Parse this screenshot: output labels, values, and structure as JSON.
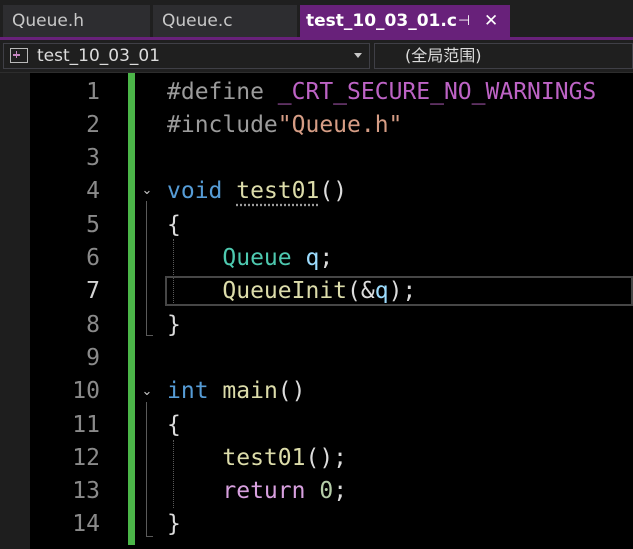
{
  "tabs": [
    {
      "label": "Queue.h",
      "active": false
    },
    {
      "label": "Queue.c",
      "active": false
    },
    {
      "label": "test_10_03_01.c",
      "active": true,
      "pin_glyph": "⊣",
      "close_glyph": "✕"
    }
  ],
  "navbar": {
    "project": "test_10_03_01",
    "scope": "(全局范围)",
    "project_icon": "project-icon",
    "dropdown_icon": "chevron-down-icon"
  },
  "colors": {
    "accent": "#68217a",
    "change_bar": "#4bb548",
    "keyword": "#569cd6",
    "type": "#4ec9b0",
    "function": "#dcdcaa",
    "string": "#d69d85",
    "macro": "#bd63c5",
    "control": "#d8a0df",
    "number": "#b5cea8"
  },
  "editor": {
    "current_line": 7,
    "line_numbers": [
      "1",
      "2",
      "3",
      "4",
      "5",
      "6",
      "7",
      "8",
      "9",
      "10",
      "11",
      "12",
      "13",
      "14"
    ],
    "code": {
      "l1_directive": "#define",
      "l1_macro": "_CRT_SECURE_NO_WARNINGS",
      "l2_directive": "#include",
      "l2_string": "\"Queue.h\"",
      "l4_kw": "void",
      "l4_fn": "test01",
      "l4_parens": "()",
      "l5": "{",
      "l6_type": "Queue",
      "l6_var": "q",
      "l6_semi": ";",
      "l7_fn": "QueueInit",
      "l7_open": "(&",
      "l7_var": "q",
      "l7_close": ");",
      "l8": "}",
      "l10_kw": "int",
      "l10_fn": "main",
      "l10_parens": "()",
      "l11": "{",
      "l12_fn": "test01",
      "l12_rest": "();",
      "l13_kw": "return",
      "l13_num": "0",
      "l13_semi": ";",
      "l14": "}"
    },
    "fold_glyph": "⌄"
  }
}
